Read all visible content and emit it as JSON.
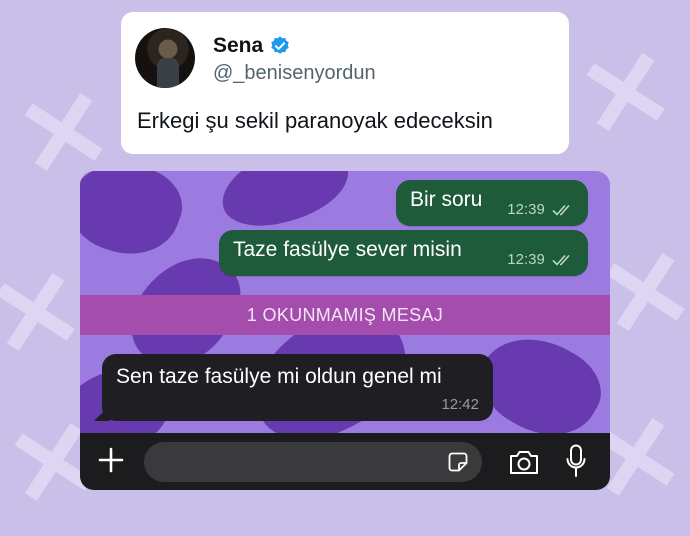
{
  "tweet": {
    "name": "Sena",
    "handle": "@_benisenyordun",
    "text": "Erkegi şu sekil paranoyak edeceksin"
  },
  "chat": {
    "outgoing": [
      {
        "text": "Bir soru",
        "time": "12:39"
      },
      {
        "text": "Taze fasülye sever misin",
        "time": "12:39"
      }
    ],
    "unread_label": "1 OKUNMAMIŞ MESAJ",
    "incoming": {
      "text": "Sen taze fasülye mi oldun genel mi",
      "time": "12:42"
    }
  },
  "colors": {
    "background": "#c9bfe8",
    "outgoing_bubble": "#1e5b3a",
    "incoming_bubble": "#1f1e22",
    "unread_bar": "#a54dad",
    "verified": "#1d9bf0"
  },
  "icons": [
    "verified-badge-icon",
    "double-check-icon",
    "plus-icon",
    "sticker-icon",
    "camera-icon",
    "microphone-icon"
  ]
}
